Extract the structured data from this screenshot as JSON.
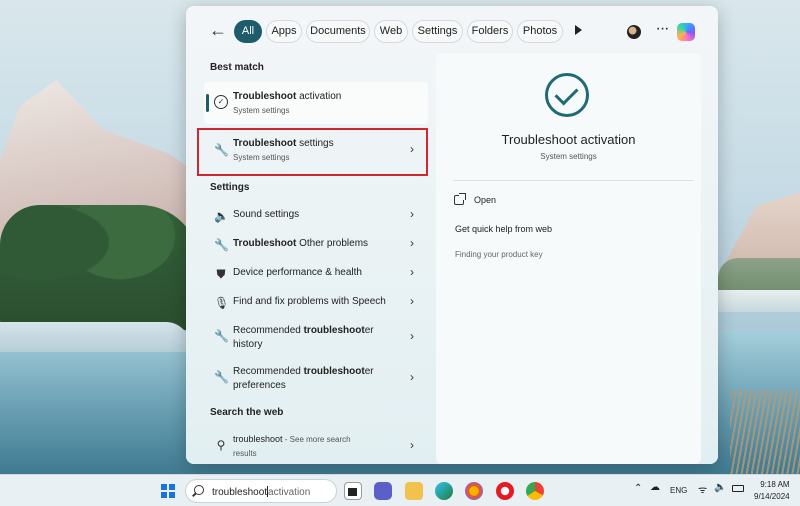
{
  "filters": {
    "back_label": "←",
    "chips": [
      "All",
      "Apps",
      "Documents",
      "Web",
      "Settings",
      "Folders",
      "Photos"
    ],
    "more_label": "···"
  },
  "best_match": {
    "section_title": "Best match",
    "title_bold": "Troubleshoot",
    "title_rest": " activation",
    "subtitle": "System settings"
  },
  "highlighted_result": {
    "title_bold": "Troubleshoot",
    "title_rest": " settings",
    "subtitle": "System settings",
    "chevron": "›"
  },
  "settings_section": {
    "section_title": "Settings",
    "items": [
      {
        "pre": "",
        "bold": "",
        "post": "Sound settings",
        "line2": ""
      },
      {
        "pre": "",
        "bold": "Troubleshoot",
        "post": " Other problems",
        "line2": ""
      },
      {
        "pre": "",
        "bold": "",
        "post": "Device performance & health",
        "line2": ""
      },
      {
        "pre": "",
        "bold": "",
        "post": "Find and fix problems with Speech",
        "line2": ""
      },
      {
        "pre": "Recommended ",
        "bold": "troubleshoot",
        "post": "er",
        "line2": "history"
      },
      {
        "pre": "Recommended ",
        "bold": "troubleshoot",
        "post": "er",
        "line2": "preferences"
      }
    ]
  },
  "web_section": {
    "section_title": "Search the web",
    "query": "troubleshoot",
    "suffix": " - See more search",
    "line2": "results"
  },
  "preview": {
    "title": "Troubleshoot activation",
    "subtitle": "System settings",
    "open_label": "Open",
    "quick_help_label": "Get quick help from web",
    "web_item": "Finding your product key"
  },
  "taskbar": {
    "search_typed": "troubleshoot",
    "search_ghost": "activation",
    "language": "ENG",
    "time": "9:18 AM",
    "date": "9/14/2024"
  },
  "colors": {
    "accent": "#1f5c6b",
    "highlight_border": "#d0272f"
  }
}
